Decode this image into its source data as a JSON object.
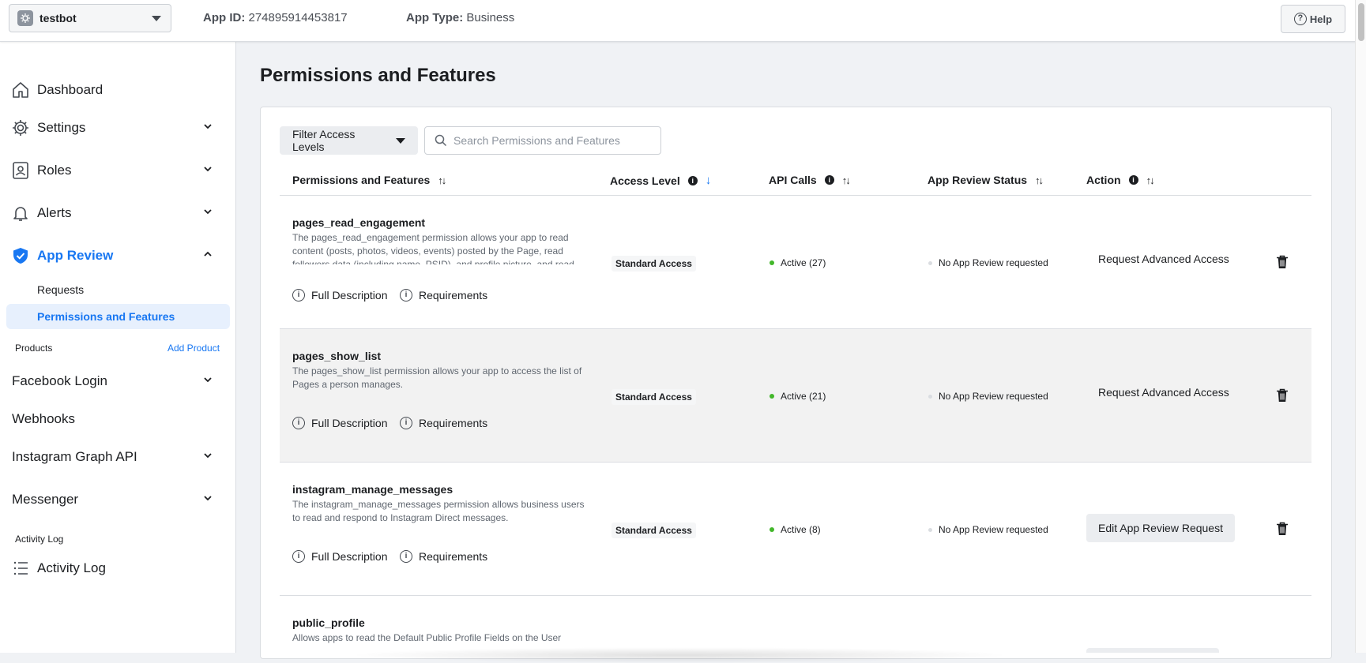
{
  "topbar": {
    "app_name": "testbot",
    "app_id_label": "App ID:",
    "app_id_value": "274895914453817",
    "app_type_label": "App Type:",
    "app_type_value": "Business",
    "help_label": "Help"
  },
  "sidebar": {
    "dashboard": "Dashboard",
    "settings": "Settings",
    "roles": "Roles",
    "alerts": "Alerts",
    "app_review": "App Review",
    "requests": "Requests",
    "permissions_features": "Permissions and Features",
    "products_label": "Products",
    "add_product": "Add Product",
    "facebook_login": "Facebook Login",
    "webhooks": "Webhooks",
    "instagram_graph_api": "Instagram Graph API",
    "messenger": "Messenger",
    "activity_log_section": "Activity Log",
    "activity_log": "Activity Log"
  },
  "main": {
    "title": "Permissions and Features",
    "filter_label": "Filter Access Levels",
    "search_placeholder": "Search Permissions and Features",
    "columns": {
      "permissions": "Permissions and Features",
      "access_level": "Access Level",
      "api_calls": "API Calls",
      "review_status": "App Review Status",
      "action": "Action"
    },
    "full_description": "Full Description",
    "requirements": "Requirements",
    "rows": [
      {
        "name": "pages_read_engagement",
        "description": "The pages_read_engagement permission allows your app to read content (posts, photos, videos, events) posted by the Page, read followers data (including name, PSID), and profile picture, and read",
        "access": "Standard Access",
        "api_calls": "Active (27)",
        "review": "No App Review requested",
        "action": "Request Advanced Access"
      },
      {
        "name": "pages_show_list",
        "description": "The pages_show_list permission allows your app to access the list of Pages a person manages.",
        "access": "Standard Access",
        "api_calls": "Active (21)",
        "review": "No App Review requested",
        "action": "Request Advanced Access"
      },
      {
        "name": "instagram_manage_messages",
        "description": "The instagram_manage_messages permission allows business users to read and respond to Instagram Direct messages.",
        "access": "Standard Access",
        "api_calls": "Active (8)",
        "review": "No App Review requested",
        "action": "Edit App Review Request"
      },
      {
        "name": "public_profile",
        "description": "Allows apps to read the Default Public Profile Fields on the User"
      }
    ]
  },
  "colors": {
    "accent": "#1877f2",
    "active_dot": "#42b72a",
    "background": "#f0f2f5"
  },
  "icons": [
    "app-logo-icon",
    "caret-down-icon",
    "help-icon",
    "home-icon",
    "gear-icon",
    "roles-icon",
    "bell-icon",
    "shield-check-icon",
    "chevron-down-icon",
    "chevron-up-icon",
    "list-icon",
    "search-icon",
    "info-icon",
    "sort-icon",
    "arrow-down-icon",
    "trash-icon"
  ]
}
